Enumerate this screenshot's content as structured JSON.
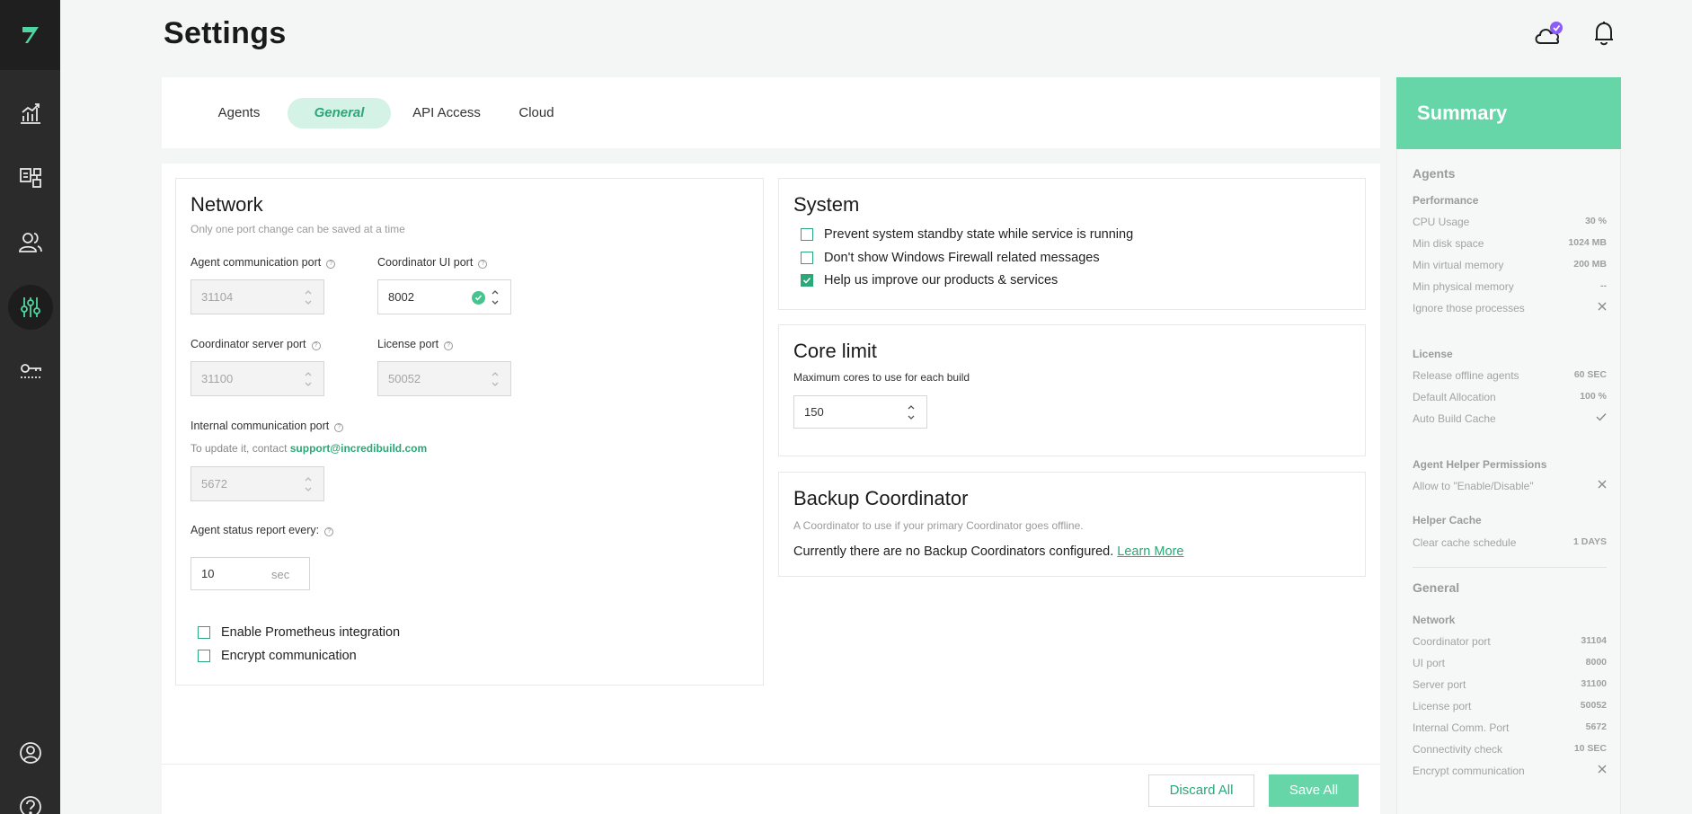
{
  "colors": {
    "accent": "#2aa877",
    "summary_header": "#66d6a9",
    "sidebar": "#2b2b2b"
  },
  "header": {
    "title": "Settings"
  },
  "sidebar": {
    "items": [
      {
        "icon": "chart-icon"
      },
      {
        "icon": "builds-icon"
      },
      {
        "icon": "users-icon"
      },
      {
        "icon": "settings-sliders-icon",
        "active": true
      },
      {
        "icon": "license-key-icon"
      }
    ],
    "bottom": [
      {
        "icon": "user-avatar-icon"
      },
      {
        "icon": "help-icon"
      }
    ]
  },
  "tabs": [
    {
      "label": "Agents"
    },
    {
      "label": "General",
      "active": true
    },
    {
      "label": "API Access"
    },
    {
      "label": "Cloud"
    }
  ],
  "network": {
    "title": "Network",
    "hint": "Only one port change can be saved at a time",
    "agent_port": {
      "label": "Agent communication port",
      "value": "31104"
    },
    "ui_port": {
      "label": "Coordinator UI port",
      "value": "8002"
    },
    "server_port": {
      "label": "Coordinator server port",
      "value": "31100"
    },
    "license_port": {
      "label": "License port",
      "value": "50052"
    },
    "internal_port": {
      "label": "Internal communication port",
      "value": "5672",
      "hint": "To update it, contact ",
      "email": "support@incredibuild.com"
    },
    "status_report": {
      "label": "Agent status report every:",
      "value": "10",
      "unit": "sec"
    },
    "prometheus": {
      "label": "Enable Prometheus integration",
      "checked": false
    },
    "encrypt": {
      "label": "Encrypt communication",
      "checked": false
    }
  },
  "system": {
    "title": "System",
    "options": [
      {
        "label": "Prevent system standby state while service is running",
        "checked": false
      },
      {
        "label": "Don't show Windows Firewall related messages",
        "checked": false
      },
      {
        "label": "Help us improve our products & services",
        "checked": true
      }
    ]
  },
  "core_limit": {
    "title": "Core limit",
    "hint": "Maximum cores to use for each build",
    "value": "150"
  },
  "backup": {
    "title": "Backup Coordinator",
    "hint": "A Coordinator to use if your primary Coordinator goes offline.",
    "text": "Currently there are no Backup Coordinators configured.",
    "link": "Learn More"
  },
  "actions": {
    "discard": "Discard All",
    "save": "Save All"
  },
  "summary": {
    "title": "Summary",
    "agents": "Agents",
    "performance": "Performance",
    "cpu": {
      "label": "CPU Usage",
      "value": "30 %"
    },
    "disk": {
      "label": "Min disk space",
      "value": "1024 MB"
    },
    "virtual": {
      "label": "Min virtual memory",
      "value": "200 MB"
    },
    "physical": {
      "label": "Min physical memory",
      "value": "--"
    },
    "ignore": {
      "label": "Ignore those processes"
    },
    "license": "License",
    "release": {
      "label": "Release offline agents",
      "value": "60 SEC"
    },
    "allocation": {
      "label": "Default Allocation",
      "value": "100 %"
    },
    "auto_cache": {
      "label": "Auto Build Cache"
    },
    "helper_perm": "Agent Helper Permissions",
    "allow": {
      "label": "Allow to \"Enable/Disable\""
    },
    "helper_cache": "Helper Cache",
    "clear": {
      "label": "Clear cache schedule",
      "value": "1 DAYS"
    },
    "general": "General",
    "network": "Network",
    "coord_port": {
      "label": "Coordinator port",
      "value": "31104"
    },
    "ui_port": {
      "label": "UI port",
      "value": "8000"
    },
    "server_port": {
      "label": "Server port",
      "value": "31100"
    },
    "license_port": {
      "label": "License port",
      "value": "50052"
    },
    "internal": {
      "label": "Internal Comm. Port",
      "value": "5672"
    },
    "connectivity": {
      "label": "Connectivity check",
      "value": "10 SEC"
    },
    "encrypt": {
      "label": "Encrypt communication"
    }
  }
}
